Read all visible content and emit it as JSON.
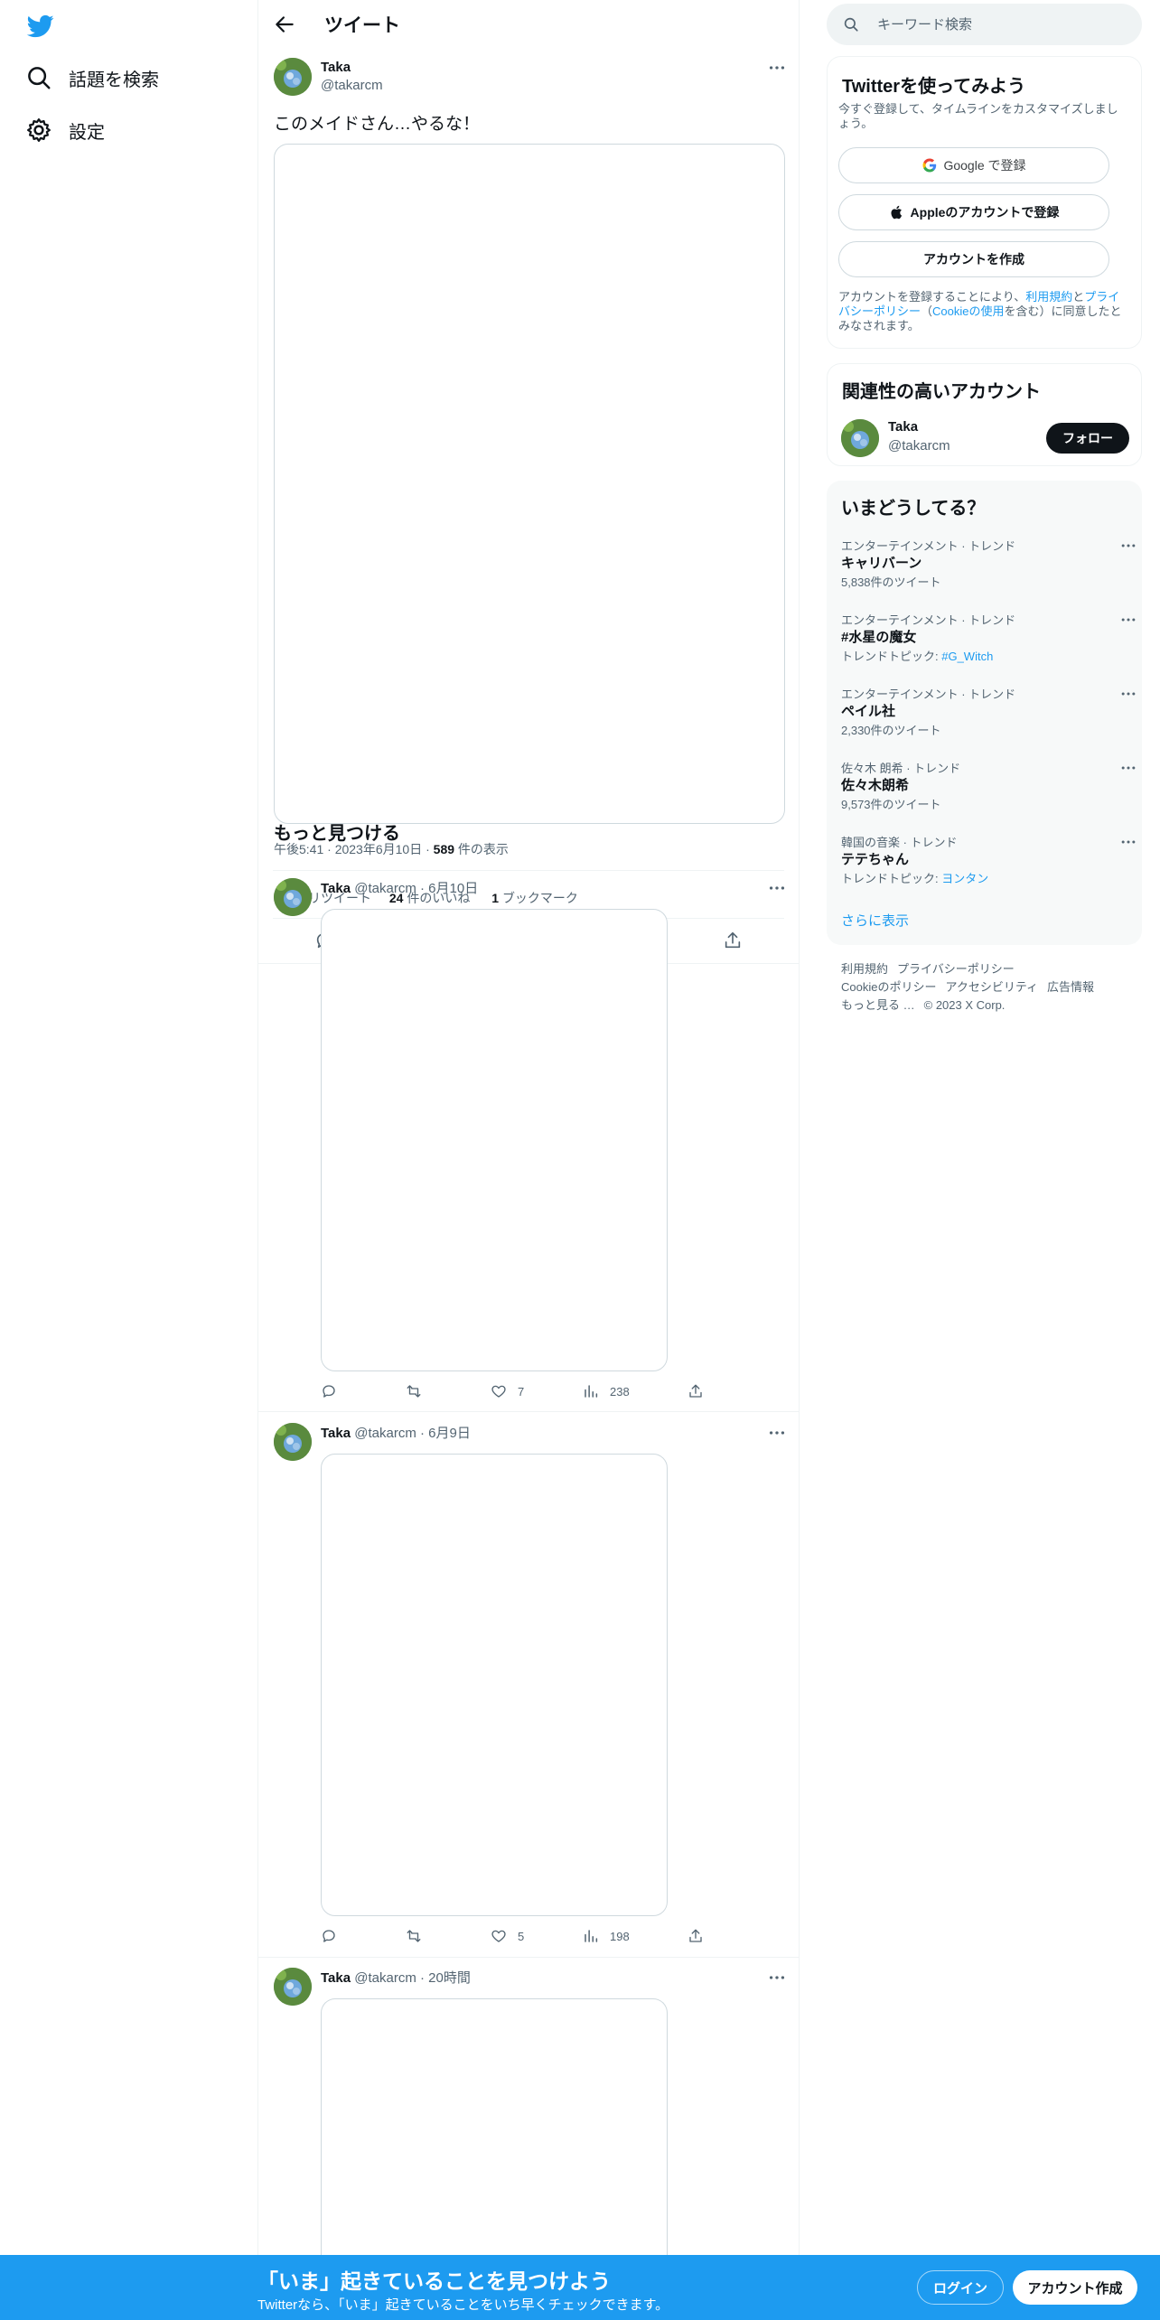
{
  "nav": {
    "explore_label": "話題を検索",
    "settings_label": "設定"
  },
  "header": {
    "title": "ツイート"
  },
  "tweet": {
    "author_name": "Taka",
    "author_handle": "@takarcm",
    "text": "このメイドさん…やるな！",
    "time": "午後5:41",
    "date": "2023年6月10日",
    "views_count": "589",
    "views_label": "件の表示",
    "retweets_label": "リツイート",
    "likes_count": "24",
    "likes_label": "件のいいね",
    "bookmarks_count": "1",
    "bookmarks_label": "ブックマーク"
  },
  "discover_title": "もっと見つける",
  "feed": [
    {
      "name": "Taka",
      "handle": "@takarcm",
      "time": "6月10日",
      "likes": "7",
      "views": "238"
    },
    {
      "name": "Taka",
      "handle": "@takarcm",
      "time": "6月9日",
      "likes": "5",
      "views": "198"
    },
    {
      "name": "Taka",
      "handle": "@takarcm",
      "time": "20時間"
    }
  ],
  "search": {
    "placeholder": "キーワード検索"
  },
  "signup_card": {
    "title": "Twitterを使ってみよう",
    "subtitle": "今すぐ登録して、タイムラインをカスタマイズしましょう。",
    "google_label": "Google で登録",
    "apple_label": "Appleのアカウントで登録",
    "create_label": "アカウントを作成",
    "legal_prefix": "アカウントを登録することにより、",
    "legal_terms": "利用規約",
    "legal_and": "と",
    "legal_privacy": "プライバシーポリシー",
    "legal_paren_open": "（",
    "legal_cookie": "Cookieの使用",
    "legal_suffix": "を含む）に同意したとみなされます。"
  },
  "related": {
    "title": "関連性の高いアカウント",
    "name": "Taka",
    "handle": "@takarcm",
    "follow_label": "フォロー"
  },
  "trends": {
    "title": "いまどうしてる？",
    "items": [
      {
        "category": "エンターテインメント · トレンド",
        "title": "キャリバーン",
        "sub": "5,838件のツイート"
      },
      {
        "category": "エンターテインメント · トレンド",
        "title": "#水星の魔女",
        "sub_prefix": "トレンドトピック: ",
        "sub_link": "#G_Witch"
      },
      {
        "category": "エンターテインメント · トレンド",
        "title": "ペイル社",
        "sub": "2,330件のツイート"
      },
      {
        "category": "佐々木 朗希 · トレンド",
        "title": "佐々木朗希",
        "sub": "9,573件のツイート"
      },
      {
        "category": "韓国の音楽 · トレンド",
        "title": "テテちゃん",
        "sub_prefix": "トレンドトピック: ",
        "sub_link": "ヨンタン"
      }
    ],
    "show_more": "さらに表示"
  },
  "footer": {
    "row1": [
      "利用規約",
      "プライバシーポリシー"
    ],
    "row2": [
      "Cookieのポリシー",
      "アクセシビリティ",
      "広告情報"
    ],
    "row3": [
      "もっと見る …",
      "© 2023 X Corp."
    ]
  },
  "banner": {
    "title": "「いま」起きていることを見つけよう",
    "subtitle": "Twitterなら、「いま」起きていることをいち早くチェックできます。",
    "login_label": "ログイン",
    "signup_label": "アカウント作成"
  },
  "colors": {
    "accent": "#1d9bf0",
    "text": "#0f1419",
    "muted": "#536471",
    "border": "#eff3f4"
  }
}
